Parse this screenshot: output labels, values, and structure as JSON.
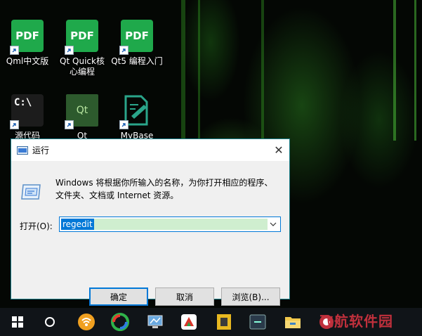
{
  "desktop": {
    "icons": [
      {
        "label": "Qml中文版",
        "tile": "PDF",
        "icon": "pdf-icon"
      },
      {
        "label": "Qt Quick核心编程",
        "tile": "PDF",
        "icon": "pdf-icon"
      },
      {
        "label": "Qt5 编程入门",
        "tile": "PDF",
        "icon": "pdf-icon"
      },
      {
        "label": "源代码",
        "tile": "C:\\",
        "icon": "command-prompt-icon"
      },
      {
        "label": "Qt",
        "tile": "Qt",
        "icon": "qt-icon"
      },
      {
        "label": "MyBase",
        "tile": "",
        "icon": "mybase-icon"
      }
    ]
  },
  "dialog": {
    "title": "运行",
    "description": "Windows 将根据你所输入的名称，为你打开相应的程序、文件夹、文档或 Internet 资源。",
    "open_label": "打开(O):",
    "input_value": "regedit",
    "ok_label": "确定",
    "cancel_label": "取消",
    "browse_label": "浏览(B)...",
    "close_glyph": "✕"
  },
  "taskbar": {
    "items": [
      "windows-start-icon",
      "cortana-circle-icon",
      "wifi-app-icon",
      "360-browser-icon",
      "remote-desktop-icon",
      "wps-presentation-icon",
      "sticky-notes-icon",
      "clock-app-icon",
      "file-explorer-icon",
      "security-app-icon"
    ]
  },
  "watermark": "飞航软件园",
  "colors": {
    "accent": "#0078d7",
    "pdf_green": "#1fa94b",
    "watermark_red": "#c0303c"
  }
}
